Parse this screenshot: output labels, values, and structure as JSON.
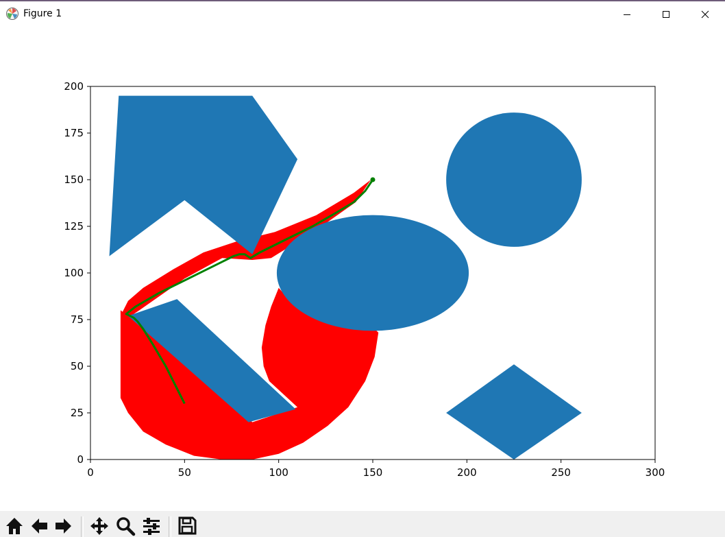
{
  "window": {
    "title": "Figure 1",
    "app_icon": "matplotlib-icon",
    "controls": [
      "minimize-icon",
      "maximize-icon",
      "close-icon"
    ]
  },
  "toolbar": {
    "buttons": [
      "home-icon",
      "back-arrow-icon",
      "forward-arrow-icon",
      "pan-icon",
      "zoom-icon",
      "configure-subplots-icon",
      "save-icon"
    ]
  },
  "chart_data": {
    "type": "scatter",
    "title": "",
    "xlabel": "",
    "ylabel": "",
    "xlim": [
      0,
      300
    ],
    "ylim": [
      0,
      200
    ],
    "x_ticks": [
      "0",
      "50",
      "100",
      "150",
      "200",
      "250",
      "300"
    ],
    "y_ticks": [
      "0",
      "25",
      "50",
      "75",
      "100",
      "125",
      "150",
      "175",
      "200"
    ],
    "grid": false,
    "legend": "none",
    "colors": {
      "obstacle": "#1f77b4",
      "explored": "#ff0000",
      "path": "#008000"
    },
    "obstacles": [
      {
        "shape": "polygon",
        "points": [
          [
            15,
            195
          ],
          [
            86,
            195
          ],
          [
            110,
            161
          ],
          [
            86,
            110
          ],
          [
            50,
            139
          ],
          [
            10,
            109
          ]
        ]
      },
      {
        "shape": "circle",
        "center": [
          225,
          150
        ],
        "radius": 36
      },
      {
        "shape": "ellipse",
        "center": [
          150,
          100
        ],
        "rx": 51,
        "ry": 31
      },
      {
        "shape": "polygon",
        "points": [
          [
            20,
            77
          ],
          [
            46,
            86
          ],
          [
            109,
            27
          ],
          [
            84,
            20
          ]
        ]
      },
      {
        "shape": "polygon",
        "points": [
          [
            189,
            25
          ],
          [
            225,
            51
          ],
          [
            261,
            25
          ],
          [
            225,
            0
          ]
        ]
      }
    ],
    "explored_region": [
      {
        "points": [
          [
            16,
            77
          ],
          [
            20,
            85
          ],
          [
            28,
            92
          ],
          [
            44,
            102
          ],
          [
            60,
            111
          ],
          [
            78,
            117
          ],
          [
            98,
            122
          ],
          [
            120,
            131
          ],
          [
            140,
            143
          ],
          [
            149,
            150
          ],
          [
            141,
            138
          ],
          [
            120,
            123
          ],
          [
            96,
            108
          ],
          [
            86,
            107
          ],
          [
            70,
            108
          ],
          [
            50,
            97
          ],
          [
            26,
            80
          ],
          [
            20,
            76
          ]
        ]
      },
      {
        "points": [
          [
            16,
            80
          ],
          [
            16,
            33
          ],
          [
            20,
            25
          ],
          [
            28,
            15
          ],
          [
            40,
            8
          ],
          [
            55,
            2
          ],
          [
            70,
            0
          ],
          [
            86,
            0
          ],
          [
            100,
            3
          ],
          [
            113,
            9
          ],
          [
            126,
            18
          ],
          [
            137,
            28
          ],
          [
            146,
            42
          ],
          [
            151,
            55
          ],
          [
            153,
            68
          ],
          [
            150,
            71
          ],
          [
            136,
            72
          ],
          [
            120,
            76
          ],
          [
            108,
            83
          ],
          [
            100,
            92
          ],
          [
            96,
            82
          ],
          [
            93,
            72
          ],
          [
            91,
            60
          ],
          [
            92,
            50
          ],
          [
            95,
            42
          ],
          [
            110,
            28
          ],
          [
            86,
            20
          ],
          [
            48,
            57
          ],
          [
            42,
            70
          ],
          [
            31,
            78
          ],
          [
            20,
            77
          ]
        ]
      }
    ],
    "path": {
      "x": [
        50,
        46,
        40,
        33,
        28,
        25,
        23,
        19,
        24,
        36,
        48,
        60,
        70,
        76,
        79,
        82,
        85,
        90,
        104,
        118,
        130,
        140,
        146,
        150
      ],
      "y": [
        30,
        38,
        50,
        62,
        70,
        74,
        76,
        78,
        82,
        89,
        95,
        101,
        106,
        109,
        110,
        110,
        108,
        111,
        118,
        125,
        132,
        138,
        144,
        150
      ]
    },
    "markers": [
      {
        "x": 150,
        "y": 150
      }
    ]
  }
}
